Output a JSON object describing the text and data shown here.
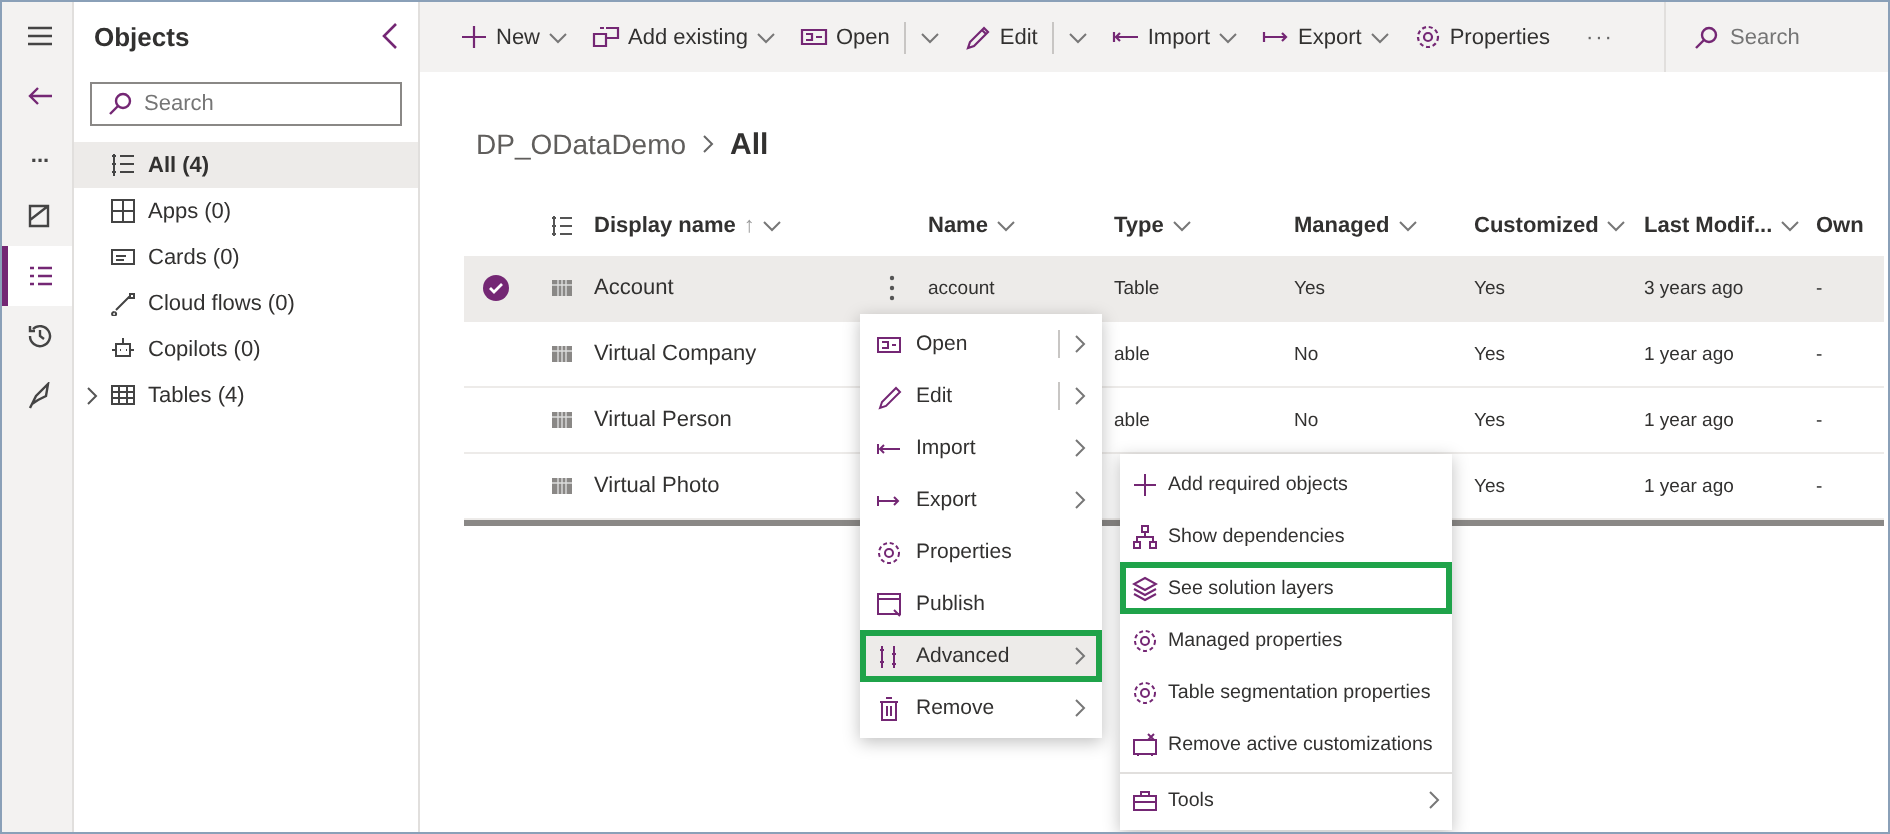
{
  "rail": [
    {
      "selected": false
    },
    {
      "selected": false
    },
    {
      "label": "...",
      "selected": false
    },
    {
      "selected": false
    },
    {
      "selected": true
    },
    {
      "selected": false
    },
    {
      "selected": false
    }
  ],
  "sidebar": {
    "title": "Objects",
    "search": {
      "placeholder": "Search"
    },
    "items": [
      {
        "label": "All",
        "count": "(4)",
        "selected": true,
        "expandable": false
      },
      {
        "label": "Apps",
        "count": "(0)",
        "selected": false,
        "expandable": false
      },
      {
        "label": "Cards",
        "count": "(0)",
        "selected": false,
        "expandable": false
      },
      {
        "label": "Cloud flows",
        "count": "(0)",
        "selected": false,
        "expandable": false
      },
      {
        "label": "Copilots",
        "count": "(0)",
        "selected": false,
        "expandable": false
      },
      {
        "label": "Tables",
        "count": "(4)",
        "selected": false,
        "expandable": true
      }
    ]
  },
  "toolbar": {
    "items": [
      {
        "label": "New",
        "dropdown": true,
        "split": false
      },
      {
        "label": "Add existing",
        "dropdown": true,
        "split": false
      },
      {
        "label": "Open",
        "dropdown": true,
        "split": true
      },
      {
        "label": "Edit",
        "dropdown": true,
        "split": true
      },
      {
        "label": "Import",
        "dropdown": true,
        "split": false
      },
      {
        "label": "Export",
        "dropdown": true,
        "split": false
      },
      {
        "label": "Properties",
        "dropdown": false,
        "split": false
      }
    ],
    "more": "···",
    "search": {
      "placeholder": "Search"
    }
  },
  "breadcrumb": {
    "parent": "DP_ODataDemo",
    "current": "All"
  },
  "table": {
    "columns": [
      {
        "label": "Display name",
        "sort": "↑"
      },
      {
        "label": "Name"
      },
      {
        "label": "Type"
      },
      {
        "label": "Managed"
      },
      {
        "label": "Customized"
      },
      {
        "label": "Last Modif..."
      },
      {
        "label": "Own"
      }
    ],
    "rows": [
      {
        "selected": true,
        "cells": [
          "Account",
          "account",
          "Table",
          "Yes",
          "Yes",
          "3 years ago",
          "-"
        ]
      },
      {
        "selected": false,
        "cells": [
          "Virtual Company",
          null,
          "able",
          "No",
          "Yes",
          "1 year ago",
          "-"
        ]
      },
      {
        "selected": false,
        "cells": [
          "Virtual Person",
          null,
          "able",
          "No",
          "Yes",
          "1 year ago",
          "-"
        ]
      },
      {
        "selected": false,
        "cells": [
          "Virtual Photo",
          null,
          null,
          null,
          "Yes",
          "1 year ago",
          "-"
        ]
      }
    ]
  },
  "context_menu": {
    "items": [
      {
        "label": "Open",
        "has_submenu": true,
        "split": true,
        "selected": false,
        "highlighted": false
      },
      {
        "label": "Edit",
        "has_submenu": true,
        "split": true,
        "selected": false,
        "highlighted": false
      },
      {
        "label": "Import",
        "has_submenu": true,
        "split": false,
        "selected": false,
        "highlighted": false
      },
      {
        "label": "Export",
        "has_submenu": true,
        "split": false,
        "selected": false,
        "highlighted": false
      },
      {
        "label": "Properties",
        "has_submenu": false,
        "split": false,
        "selected": false,
        "highlighted": false
      },
      {
        "label": "Publish",
        "has_submenu": false,
        "split": false,
        "selected": false,
        "highlighted": false
      },
      {
        "label": "Advanced",
        "has_submenu": true,
        "split": false,
        "selected": true,
        "highlighted": true
      },
      {
        "label": "Remove",
        "has_submenu": true,
        "split": false,
        "selected": false,
        "highlighted": false
      }
    ]
  },
  "submenu": {
    "items": [
      {
        "label": "Add required objects",
        "has_submenu": false,
        "highlighted": false,
        "divider_after": false
      },
      {
        "label": "Show dependencies",
        "has_submenu": false,
        "highlighted": false,
        "divider_after": false
      },
      {
        "label": "See solution layers",
        "has_submenu": false,
        "highlighted": true,
        "divider_after": false
      },
      {
        "label": "Managed properties",
        "has_submenu": false,
        "highlighted": false,
        "divider_after": false
      },
      {
        "label": "Table segmentation properties",
        "has_submenu": false,
        "highlighted": false,
        "divider_after": false
      },
      {
        "label": "Remove active customizations",
        "has_submenu": false,
        "highlighted": false,
        "divider_after": true
      },
      {
        "label": "Tools",
        "has_submenu": true,
        "highlighted": false,
        "divider_after": false
      }
    ]
  }
}
